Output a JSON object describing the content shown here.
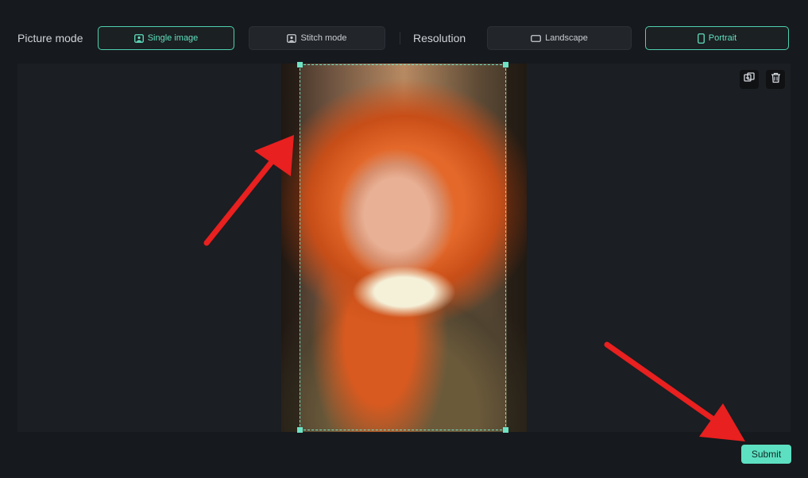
{
  "toolbar": {
    "picture_mode_label": "Picture mode",
    "resolution_label": "Resolution",
    "picture_modes": [
      {
        "label": "Single image",
        "icon": "image-icon",
        "active": true
      },
      {
        "label": "Stitch mode",
        "icon": "stitch-icon",
        "active": false
      }
    ],
    "resolutions": [
      {
        "label": "Landscape",
        "icon": "landscape-icon",
        "active": false
      },
      {
        "label": "Portrait",
        "icon": "portrait-icon",
        "active": true
      }
    ]
  },
  "canvas": {
    "image_subject": "portrait photo of smiling woman with long red curly hair",
    "tools": [
      {
        "name": "replace-image-icon"
      },
      {
        "name": "trash-icon"
      }
    ]
  },
  "footer": {
    "submit_label": "Submit"
  },
  "colors": {
    "accent": "#4fd1b1",
    "background": "#16191d",
    "annotation_arrow": "#e8201f"
  }
}
